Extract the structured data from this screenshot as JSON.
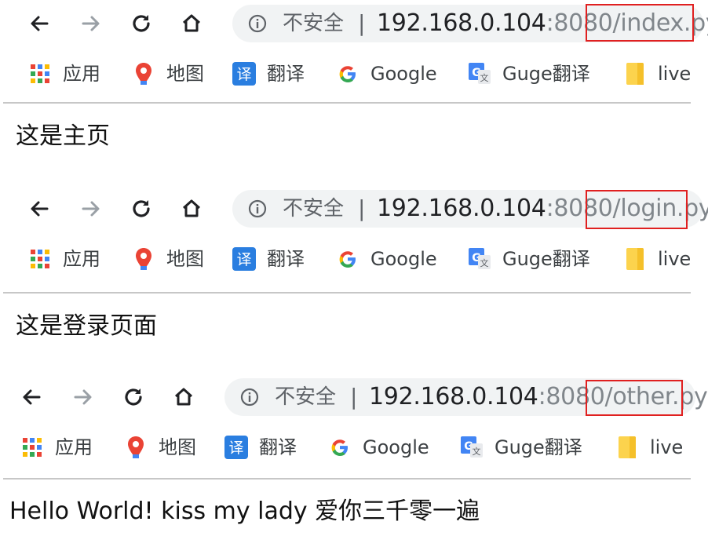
{
  "shots": [
    {
      "insecure_label": "不安全",
      "separator": "|",
      "url_host": "192.168.0.104",
      "url_port": ":8080",
      "url_path": "/index.py",
      "page_text": "这是主页"
    },
    {
      "insecure_label": "不安全",
      "separator": "|",
      "url_host": "192.168.0.104",
      "url_port": ":8080",
      "url_path": "/login.py",
      "page_text": "这是登录页面"
    },
    {
      "insecure_label": "不安全",
      "separator": "|",
      "url_host": "192.168.0.104",
      "url_port": ":8080",
      "url_path": "/other.py",
      "page_text": "Hello World! kiss my lady 爱你三千零一遍"
    }
  ],
  "bookmarks": [
    {
      "label": "应用",
      "icon": "apps-grid-icon"
    },
    {
      "label": "地图",
      "icon": "maps-pin-icon"
    },
    {
      "label": "翻译",
      "icon": "translate-icon"
    },
    {
      "label": "Google",
      "icon": "google-g-icon"
    },
    {
      "label": "Guge翻译",
      "icon": "google-translate-icon"
    },
    {
      "label": "live",
      "icon": "folder-icon"
    }
  ],
  "colors": {
    "highlight_box": "#e02020",
    "omnibox_bg": "#f1f3f4",
    "url_dim": "#80868b"
  }
}
